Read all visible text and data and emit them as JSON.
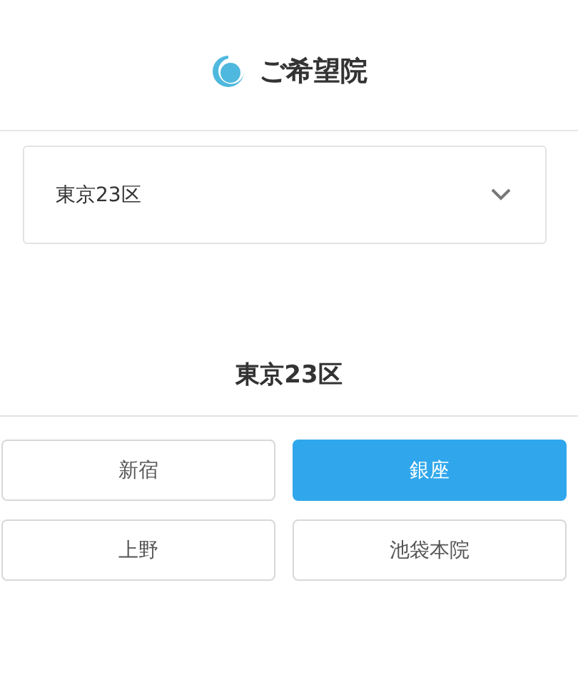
{
  "header": {
    "title": "ご希望院"
  },
  "select": {
    "value": "東京23区"
  },
  "section": {
    "title": "東京23区",
    "clinics": [
      {
        "label": "新宿",
        "selected": false
      },
      {
        "label": "銀座",
        "selected": true
      },
      {
        "label": "上野",
        "selected": false
      },
      {
        "label": "池袋本院",
        "selected": false
      }
    ]
  }
}
